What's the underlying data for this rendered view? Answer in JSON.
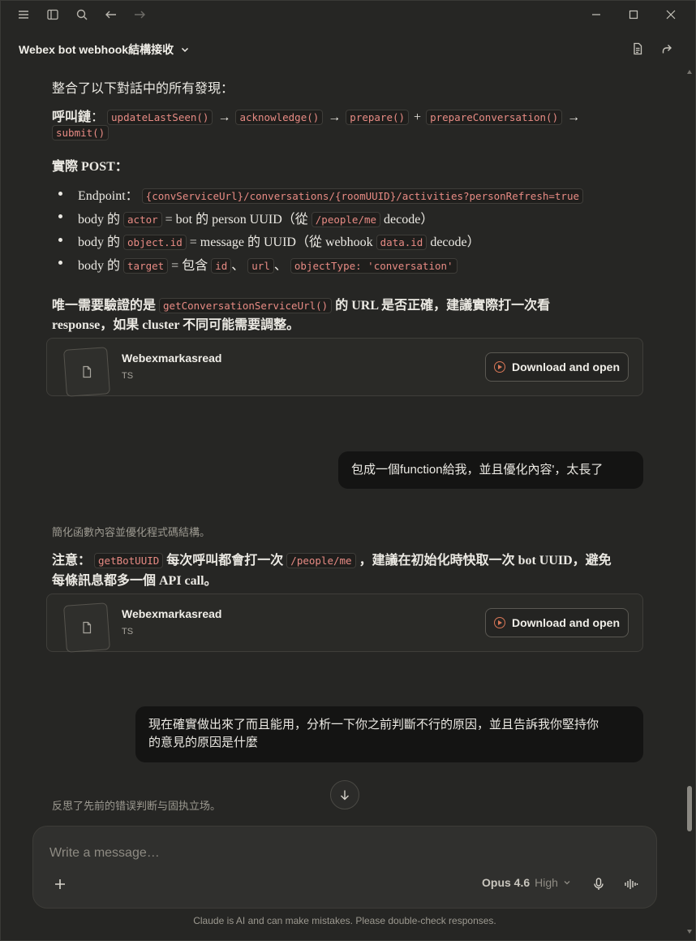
{
  "titlebar": {
    "icons": [
      "menu-icon",
      "sidebar-icon",
      "search-icon",
      "back-arrow-icon",
      "forward-arrow-icon"
    ],
    "window_controls": [
      "minimize-icon",
      "maximize-icon",
      "close-icon"
    ]
  },
  "header": {
    "title": "Webex bot webhook結構接收"
  },
  "message1": {
    "intro": "整合了以下對話中的所有發現：",
    "call_chain_label": "呼叫鏈",
    "call_chain": [
      "updateLastSeen()",
      "acknowledge()",
      "prepare()",
      "prepareConversation()",
      "submit()"
    ],
    "actual_post_label": "實際 POST",
    "bullets": {
      "endpoint_label": "Endpoint：",
      "endpoint_code": "{convServiceUrl}/conversations/{roomUUID}/activities?personRefresh=true",
      "b2_prefix": "body 的",
      "b2_code": "actor",
      "b2_mid": "= bot 的 person UUID（從",
      "b2_code2": "/people/me",
      "b2_suffix": "decode）",
      "b3_prefix": "body 的",
      "b3_code": "object.id",
      "b3_mid": "= message 的 UUID（從 webhook",
      "b3_code2": "data.id",
      "b3_suffix": "decode）",
      "b4_prefix": "body 的",
      "b4_code": "target",
      "b4_mid": "= 包含",
      "b4_code2": "id",
      "b4_sep1": "、",
      "b4_code3": "url",
      "b4_sep2": "、",
      "b4_code4": "objectType: 'conversation'"
    },
    "verify_prefix": "唯一需要驗證的是",
    "verify_code": "getConversationServiceUrl()",
    "verify_suffix": "的 URL 是否正確，建議實際打一次看",
    "verify_line2": "response，如果 cluster 不同可能需要調整。",
    "file": {
      "name": "Webexmarkasread",
      "type": "TS",
      "button": "Download and open"
    }
  },
  "user_message1": "包成一個function給我，並且優化內容'，太長了",
  "message2": {
    "thought": "簡化函數內容並優化程式碼結構。",
    "note_prefix": "注意：",
    "note_code": "getBotUUID",
    "note_mid": "每次呼叫都會打一次",
    "note_code2": "/people/me",
    "note_suffix": "，建議在初始化時快取一次 bot UUID，避免",
    "note_line2": "每條訊息都多一個 API call。",
    "file": {
      "name": "Webexmarkasread",
      "type": "TS",
      "button": "Download and open"
    }
  },
  "user_message2": {
    "line1": "現在確實做出來了而且能用，分析一下你之前判斷不行的原因，並且告訴我你堅持你",
    "line2": "的意見的原因是什麼"
  },
  "message3": {
    "thought": "反思了先前的错误判断与固执立场。"
  },
  "composer": {
    "placeholder": "Write a message…",
    "model": "Opus 4.6",
    "effort": "High"
  },
  "disclaimer": "Claude is AI and can make mistakes. Please double-check responses.",
  "colors": {
    "background": "#262624",
    "code_text": "#e88b84",
    "accent": "#d97757",
    "user_bubble": "#141413"
  }
}
